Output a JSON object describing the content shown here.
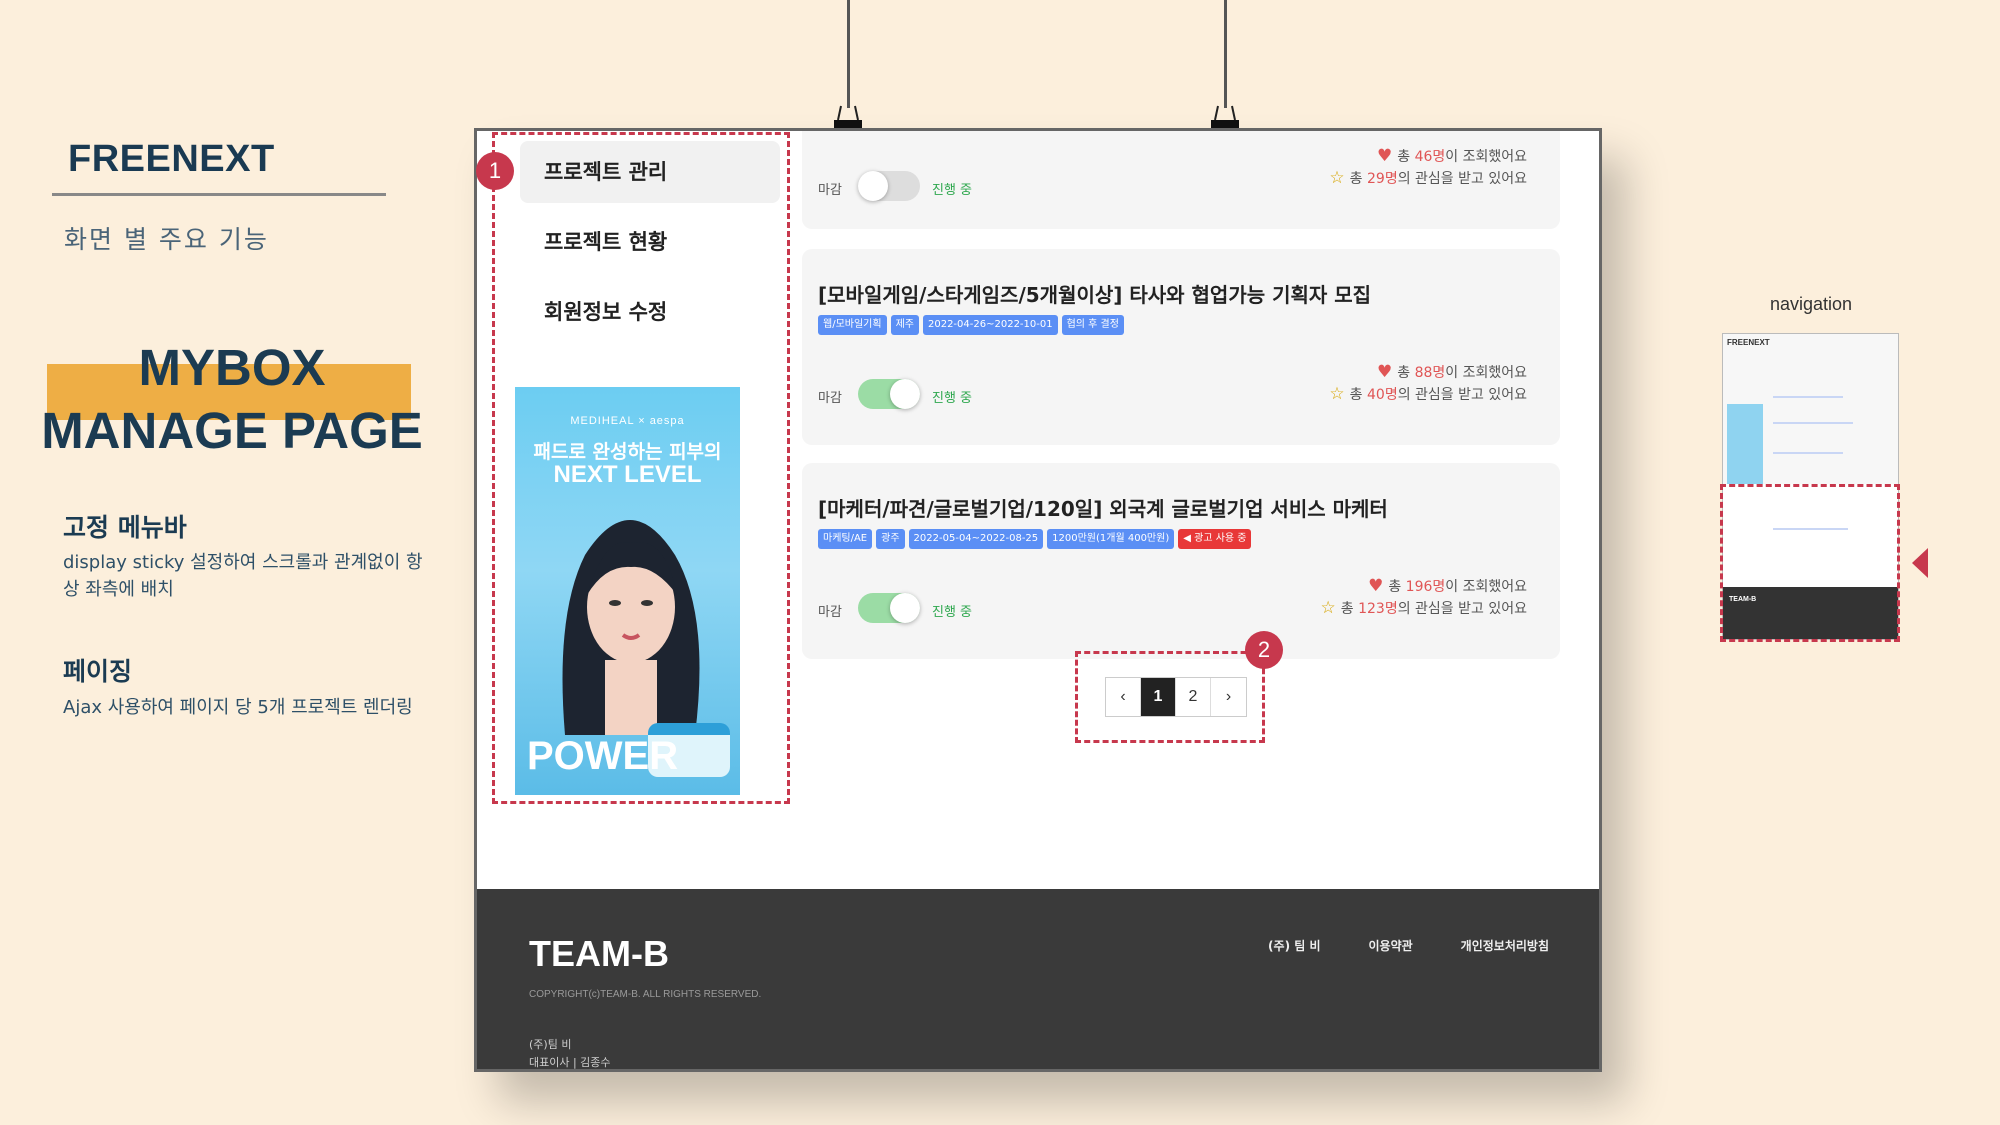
{
  "brand": "FREENEXT",
  "subtitle": "화면 별 주요 기능",
  "page_title_line1": "MYBOX",
  "page_title_line2": "MANAGE PAGE",
  "features": [
    {
      "title": "고정 메뉴바",
      "desc": "display sticky 설정하여 스크롤과 관계없이 항상 좌측에 배치"
    },
    {
      "title": "페이징",
      "desc": "Ajax 사용하여 페이지 당 5개 프로젝트 렌더링"
    }
  ],
  "menu": [
    "프로젝트 관리",
    "프로젝트 현황",
    "회원정보 수정"
  ],
  "ad": {
    "brand_line": "MEDIHEAL × aespa",
    "line1": "패드로 완성하는 피부의",
    "line2": "NEXT LEVEL",
    "power": "POWER"
  },
  "cards": [
    {
      "deadline_label": "마감",
      "status": "진행 중",
      "toggle_on": false,
      "views_pre": "총 ",
      "views": "46명",
      "views_post": "이 조회했어요",
      "likes_pre": "총 ",
      "likes": "29명",
      "likes_post": "의 관심을 받고 있어요"
    },
    {
      "title": "[모바일게임/스타게임즈/5개월이상] 타사와 협업가능 기획자 모집",
      "tags": [
        "웹/모바일기획",
        "제주",
        "2022-04-26~2022-10-01",
        "협의 후 결정"
      ],
      "deadline_label": "마감",
      "status": "진행 중",
      "toggle_on": true,
      "views_pre": "총 ",
      "views": "88명",
      "views_post": "이 조회했어요",
      "likes_pre": "총 ",
      "likes": "40명",
      "likes_post": "의 관심을 받고 있어요"
    },
    {
      "title": "[마케터/파견/글로벌기업/120일] 외국계 글로벌기업 서비스 마케터",
      "tags": [
        "마케팅/AE",
        "광주",
        "2022-05-04~2022-08-25",
        "1200만원(1개월 400만원)"
      ],
      "ad_tag": "◀ 광고 사용 중",
      "deadline_label": "마감",
      "status": "진행 중",
      "toggle_on": true,
      "views_pre": "총 ",
      "views": "196명",
      "views_post": "이 조회했어요",
      "likes_pre": "총 ",
      "likes": "123명",
      "likes_post": "의 관심을 받고 있어요"
    }
  ],
  "pagination": {
    "prev": "‹",
    "pages": [
      "1",
      "2"
    ],
    "current": "1",
    "next": "›"
  },
  "footer": {
    "logo": "TEAM-B",
    "copyright": "COPYRIGHT(c)TEAM-B. ALL RIGHTS RESERVED.",
    "company": "(주)팀 비",
    "ceo": "대표이사 | 김종수",
    "links": [
      "(주) 팀 비",
      "이용약관",
      "개인정보처리방침"
    ]
  },
  "callouts": [
    "1",
    "2"
  ],
  "navigation_label": "navigation",
  "thumbnail": {
    "logo": "FREENEXT",
    "footer_logo": "TEAM-B"
  },
  "colors": {
    "background": "#fcefdc",
    "accent": "#eeae45",
    "callout": "#c7384d",
    "title": "#1b3b52",
    "tag": "#5b8ff5"
  },
  "icons": {
    "views": "heart-icon",
    "likes": "star-icon",
    "indicator": "arrow-left-icon"
  }
}
